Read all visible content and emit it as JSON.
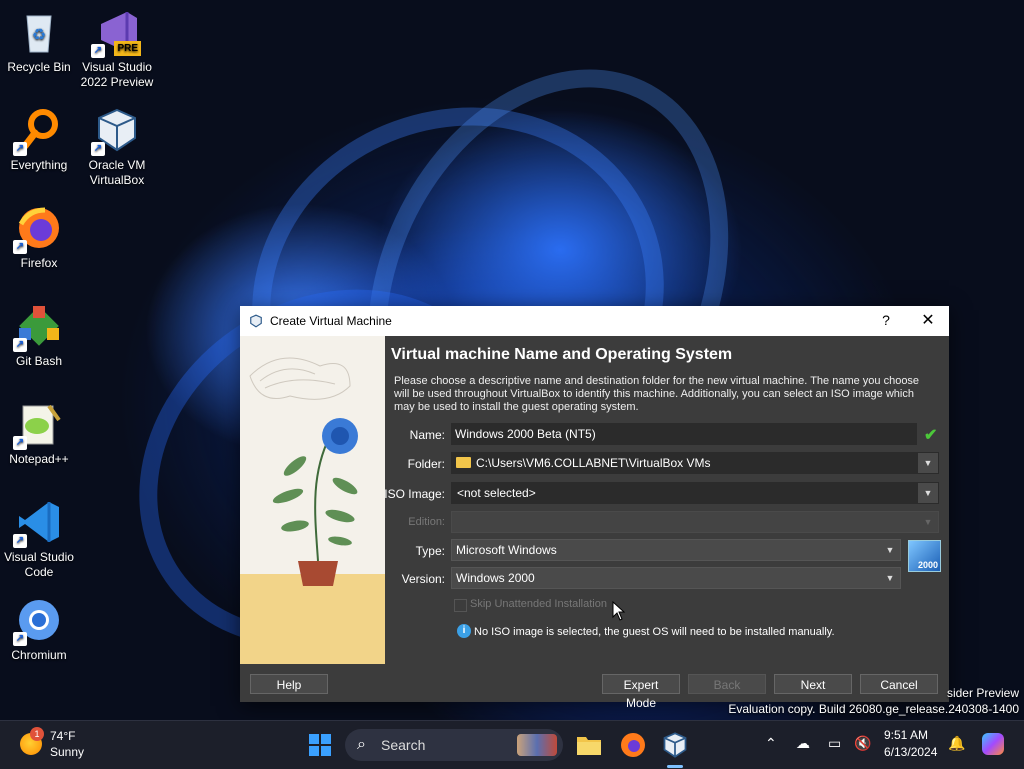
{
  "desktop": {
    "icons": [
      {
        "label": "Recycle Bin"
      },
      {
        "label": "Visual Studio 2022 Preview",
        "badge": "PRE"
      },
      {
        "label": "Everything"
      },
      {
        "label": "Oracle VM VirtualBox"
      },
      {
        "label": "Firefox"
      },
      {
        "label": "Git Bash"
      },
      {
        "label": "Notepad++"
      },
      {
        "label": "Visual Studio Code"
      },
      {
        "label": "Chromium"
      }
    ],
    "watermark_line1": "sider Preview",
    "watermark_line2": "Evaluation copy. Build 26080.ge_release.240308-1400"
  },
  "dialog": {
    "title": "Create Virtual Machine",
    "help_glyph": "?",
    "close_glyph": "✕",
    "heading": "Virtual machine Name and Operating System",
    "description": "Please choose a descriptive name and destination folder for the new virtual machine. The name you choose will be used throughout VirtualBox to identify this machine. Additionally, you can select an ISO image which may be used to install the guest operating system.",
    "labels": {
      "name": "Name:",
      "folder": "Folder:",
      "iso": "ISO Image:",
      "edition": "Edition:",
      "type": "Type:",
      "version": "Version:"
    },
    "values": {
      "name": "Windows 2000 Beta (NT5)",
      "folder": "C:\\Users\\VM6.COLLABNET\\VirtualBox VMs",
      "iso": "<not selected>",
      "edition": "",
      "type": "Microsoft Windows",
      "version": "Windows 2000"
    },
    "os_icon_label": "2000",
    "skip_unattended": "Skip Unattended Installation",
    "info_text": "No ISO image is selected, the guest OS will need to be installed manually.",
    "buttons": {
      "help": "Help",
      "expert": "Expert Mode",
      "back": "Back",
      "next": "Next",
      "cancel": "Cancel"
    }
  },
  "taskbar": {
    "weather_temp": "74°F",
    "weather_cond": "Sunny",
    "weather_badge": "1",
    "search_placeholder": "Search",
    "time": "9:51 AM",
    "date": "6/13/2024"
  },
  "colors": {
    "accent": "#3aa0ff",
    "dialog_bg": "#3c3c3c",
    "valid_check": "#4cc83a"
  }
}
